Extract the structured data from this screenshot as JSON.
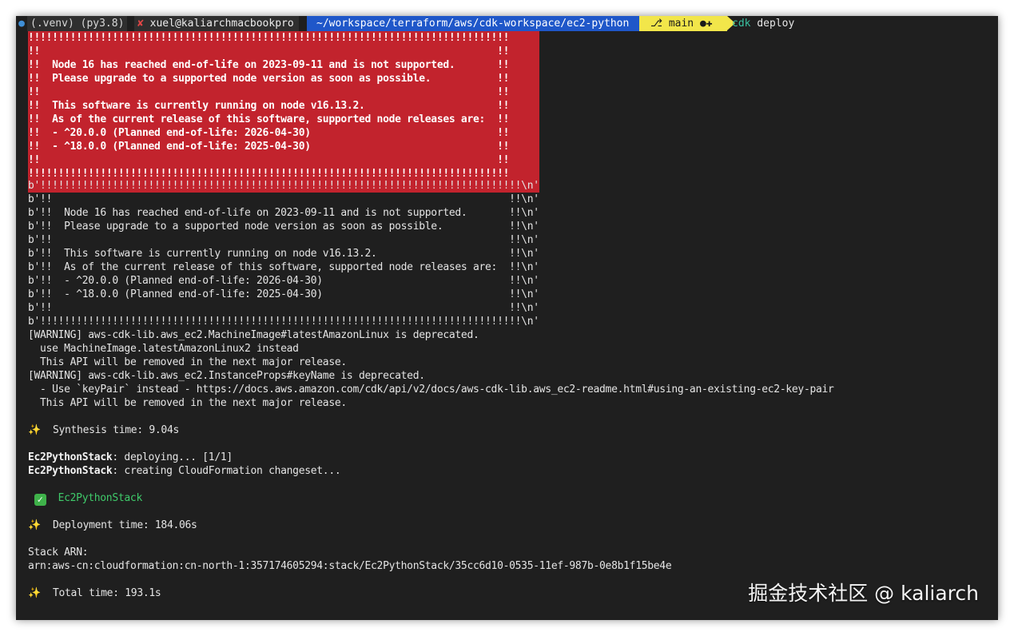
{
  "prompt": {
    "env": "(.venv) (py3.8)",
    "host_mark": "✘",
    "host": "xuel@kaliarchmacbookpro",
    "path": "~/workspace/terraform/aws/cdk-workspace/ec2-python",
    "git_icon": "branch-icon",
    "git": "main ●✚",
    "command": "cdk",
    "args": "deploy"
  },
  "node_warning_box": [
    "!!!!!!!!!!!!!!!!!!!!!!!!!!!!!!!!!!!!!!!!!!!!!!!!!!!!!!!!!!!!!!!!!!!!!!!!!!!!!!!!",
    "!!                                                                            !!",
    "!!  Node 16 has reached end-of-life on 2023-09-11 and is not supported.       !!",
    "!!  Please upgrade to a supported node version as soon as possible.           !!",
    "!!                                                                            !!",
    "!!  This software is currently running on node v16.13.2.                      !!",
    "!!  As of the current release of this software, supported node releases are:  !!",
    "!!  - ^20.0.0 (Planned end-of-life: 2026-04-30)                               !!",
    "!!  - ^18.0.0 (Planned end-of-life: 2025-04-30)                               !!",
    "!!                                                                            !!",
    "!!!!!!!!!!!!!!!!!!!!!!!!!!!!!!!!!!!!!!!!!!!!!!!!!!!!!!!!!!!!!!!!!!!!!!!!!!!!!!!!"
  ],
  "bytes_output": [
    "b'!!!!!!!!!!!!!!!!!!!!!!!!!!!!!!!!!!!!!!!!!!!!!!!!!!!!!!!!!!!!!!!!!!!!!!!!!!!!!!!!\\n'",
    "b'!!                                                                            !!\\n'",
    "b'!!  Node 16 has reached end-of-life on 2023-09-11 and is not supported.       !!\\n'",
    "b'!!  Please upgrade to a supported node version as soon as possible.           !!\\n'",
    "b'!!                                                                            !!\\n'",
    "b'!!  This software is currently running on node v16.13.2.                      !!\\n'",
    "b'!!  As of the current release of this software, supported node releases are:  !!\\n'",
    "b'!!  - ^20.0.0 (Planned end-of-life: 2026-04-30)                               !!\\n'",
    "b'!!  - ^18.0.0 (Planned end-of-life: 2025-04-30)                               !!\\n'",
    "b'!!                                                                            !!\\n'",
    "b'!!!!!!!!!!!!!!!!!!!!!!!!!!!!!!!!!!!!!!!!!!!!!!!!!!!!!!!!!!!!!!!!!!!!!!!!!!!!!!!!\\n'"
  ],
  "deprecations": [
    "[WARNING] aws-cdk-lib.aws_ec2.MachineImage#latestAmazonLinux is deprecated.",
    "  use MachineImage.latestAmazonLinux2 instead",
    "  This API will be removed in the next major release.",
    "[WARNING] aws-cdk-lib.aws_ec2.InstanceProps#keyName is deprecated.",
    "  - Use `keyPair` instead - https://docs.aws.amazon.com/cdk/api/v2/docs/aws-cdk-lib.aws_ec2-readme.html#using-an-existing-ec2-key-pair",
    "  This API will be removed in the next major release."
  ],
  "synth": {
    "icon": "✨",
    "text": "  Synthesis time: 9.04s"
  },
  "deploy": {
    "stack": "Ec2PythonStack",
    "line1_rest": ": deploying... [1/1]",
    "line2_rest": ": creating CloudFormation changeset..."
  },
  "success": {
    "icon": "✓",
    "stack": "Ec2PythonStack"
  },
  "deploy_time": {
    "icon": "✨",
    "text": "  Deployment time: 184.06s"
  },
  "arn": {
    "label": "Stack ARN:",
    "value": "arn:aws-cn:cloudformation:cn-north-1:357174605294:stack/Ec2PythonStack/35cc6d10-0535-11ef-987b-0e8b1f15be4e"
  },
  "total_time": {
    "icon": "✨",
    "text": "  Total time: 193.1s"
  },
  "watermark": "掘金技术社区 @ kaliarch"
}
